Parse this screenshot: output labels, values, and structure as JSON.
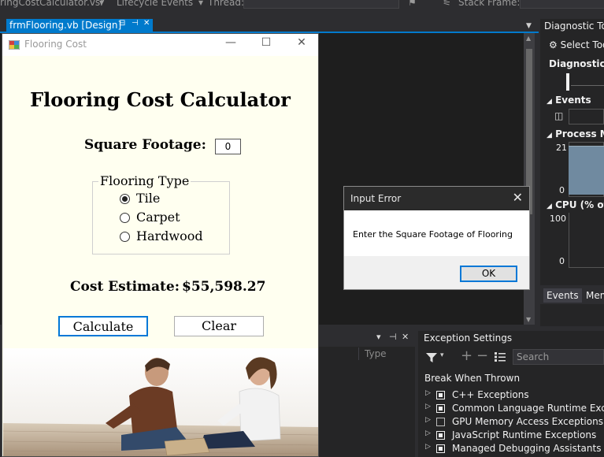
{
  "vs_toolbar": {
    "project_file": "ringCostCalculator.vsr",
    "lifecycle_events": "Lifecycle Events",
    "thread_label": "Thread:",
    "stack_frame_label": "Stack Frame:"
  },
  "doc_tab": {
    "label": "frmFlooring.vb [Design]",
    "pin_glyph": "⊟",
    "dock_glyph": "⊣",
    "close_glyph": "✕"
  },
  "form": {
    "window_title": "Flooring Cost",
    "minimize_glyph": "—",
    "maximize_glyph": "☐",
    "close_glyph": "✕",
    "heading": "Flooring Cost Calculator",
    "square_footage_label": "Square Footage:",
    "square_footage_value": "0",
    "flooring_type_legend": "Flooring Type",
    "flooring_options": [
      {
        "label": "Tile",
        "selected": true
      },
      {
        "label": "Carpet",
        "selected": false
      },
      {
        "label": "Hardwood",
        "selected": false
      }
    ],
    "cost_label": "Cost Estimate:",
    "cost_value": "$55,598.27",
    "calculate_label": "Calculate",
    "clear_label": "Clear"
  },
  "input_error_dialog": {
    "title": "Input Error",
    "message": "Enter the Square Footage of Flooring",
    "ok_label": "OK",
    "close_glyph": "✕"
  },
  "bottom_left_panel": {
    "column_header": "Type",
    "dropdown_glyph": "▾",
    "pin_glyph": "⊣",
    "close_glyph": "✕"
  },
  "exception_settings": {
    "title": "Exception Settings",
    "search_placeholder": "Search",
    "break_when_thrown": "Break When Thrown",
    "items": [
      {
        "label": "C++ Exceptions",
        "checked": true
      },
      {
        "label": "Common Language Runtime Excepti",
        "checked": true
      },
      {
        "label": "GPU Memory Access Exceptions",
        "checked": false
      },
      {
        "label": "JavaScript Runtime Exceptions",
        "checked": true
      },
      {
        "label": "Managed Debugging Assistants",
        "checked": true
      }
    ]
  },
  "diagnostic_tools": {
    "title": "Diagnostic Too",
    "select_tools": "Select Too",
    "diagnostics_session": "Diagnostics s",
    "events_section": "Events",
    "process_memory_section": "Process Mem",
    "memory_max": "21",
    "memory_min": "0",
    "cpu_section": "CPU (% of a",
    "cpu_max": "100",
    "cpu_min": "0",
    "tabs": [
      "Events",
      "Mem"
    ]
  },
  "colors": {
    "vs_background": "#2d2d30",
    "vs_accent": "#007acc",
    "form_background": "#fffff0",
    "dialog_titlebar": "#2b2b2b",
    "button_focus": "#0078d7",
    "memory_fill": "#708aa0"
  }
}
